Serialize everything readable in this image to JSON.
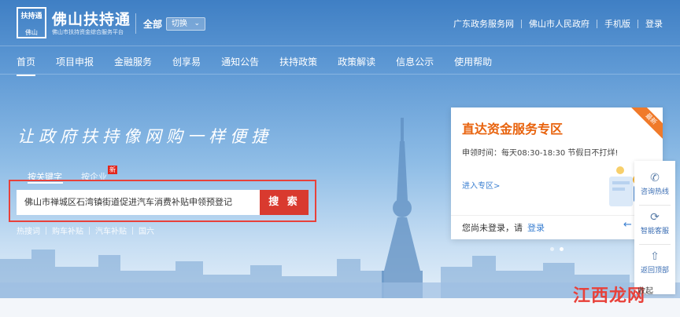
{
  "header": {
    "logo_top": "扶持通",
    "logo_bottom": "佛山",
    "brand_title": "佛山扶持通",
    "brand_subtitle": "佛山市扶持资金综合服务平台",
    "region": "全部",
    "switch_label": "切换",
    "top_links": [
      "广东政务服务网",
      "佛山市人民政府",
      "手机版",
      "登录"
    ]
  },
  "nav": {
    "items": [
      "首页",
      "项目申报",
      "金融服务",
      "创享易",
      "通知公告",
      "扶持政策",
      "政策解读",
      "信息公示",
      "使用帮助"
    ],
    "active_index": 0
  },
  "hero": {
    "slogan": "让政府扶持像网购一样便捷"
  },
  "search": {
    "tab_keyword": "按关键字",
    "tab_enterprise": "按企业",
    "new_badge": "新",
    "value": "佛山市禅城区石湾镇街道促进汽车消费补贴申领预登记",
    "button_label": "搜 索",
    "hot_words": [
      "热搜词",
      "购车补贴",
      "汽车补贴",
      "国六"
    ]
  },
  "service_card": {
    "title": "直达资金服务专区",
    "ribbon": "最新",
    "time_text": "申领时间：每天08:30-18:30 节假日不打烊!",
    "enter_link": "进入专区>",
    "login_prompt": "您尚未登录，请",
    "login_link": "登录",
    "arrow": "←"
  },
  "carousel": {
    "count": 2,
    "active_index": 1
  },
  "side_tools": [
    {
      "icon": "phone-icon",
      "glyph": "✆",
      "label": "咨询热线"
    },
    {
      "icon": "chat-icon",
      "glyph": "⟳",
      "label": "智能客服"
    },
    {
      "icon": "to-top-icon",
      "glyph": "⇧",
      "label": "返回顶部"
    }
  ],
  "watermark": {
    "text": "江西龙网",
    "extra": "收起"
  },
  "colors": {
    "accent_red": "#d93a2f",
    "card_title_orange": "#e8620c",
    "link_blue": "#3a7fd1",
    "sky_top": "#3f7fc4"
  }
}
